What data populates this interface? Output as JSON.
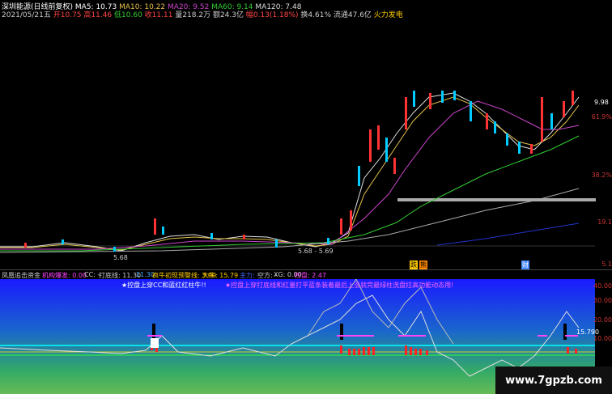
{
  "header": {
    "stock": "深圳能源(日线前复权)",
    "ma5": "MA5: 10.73",
    "ma10": "MA10: 10.22",
    "ma20": "MA20: 9.52",
    "ma60": "MA60: 9.14",
    "ma120": "MA120: 7.48",
    "date": "2021/05/21五",
    "open": "开10.75",
    "high": "高11.46",
    "low": "低10.60",
    "close": "收11.11",
    "volume": "量218.2万",
    "amount": "额24.3亿",
    "change": "幅0.13(1.18%)",
    "turnover": "换4.61%",
    "float": "流通47.6亿",
    "industry": "火力发电"
  },
  "price_labels": {
    "low_label": "5.68",
    "range_label": "5.68 - 5.69",
    "right_top": "9.98",
    "axis": [
      "61.9%",
      "38.2%",
      "19.1",
      "5.1"
    ]
  },
  "markers": {
    "buy1": "跌",
    "sell1": "熊",
    "buy2": "财"
  },
  "indicator_bar": {
    "name": "凤凰追击资金",
    "jg": "机构爆发: 0.00",
    "cc": "CC: -",
    "dlx": "打底线: 11.30",
    "dlx2": "11.30",
    "fx": "疯牛初现预警线: 3.00",
    "dn": "大牛: 15.79",
    "zl": "主力: -",
    "kf": "空方: -",
    "xg": "XG: 0.00",
    "kp": "控盘: 2.47"
  },
  "bottom": {
    "note_left": "★控盘上穿CC和蓝红红柱牛!!",
    "note_right": "★控盘上穿打底线和红量打平蓝条装着最后上涨就完最绿柱洗盘拉高功能动态用!",
    "axis": [
      "40.00",
      "30.00",
      "20.00",
      "10.00"
    ],
    "value_label": "15.790"
  },
  "watermark": "www.7gpzb.com"
}
